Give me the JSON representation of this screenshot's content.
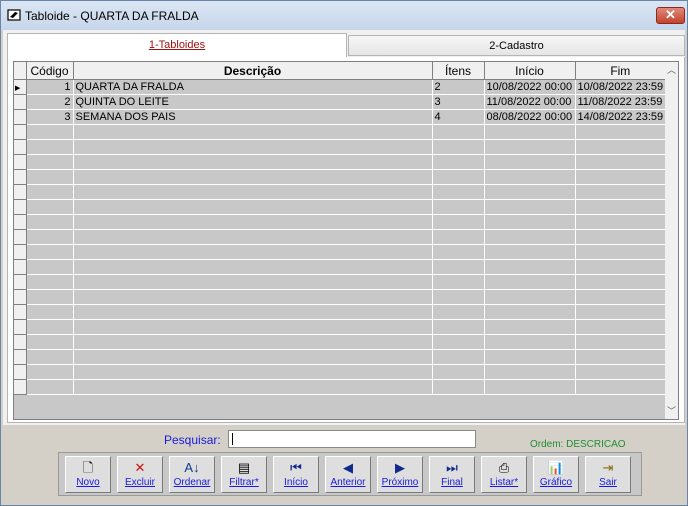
{
  "window": {
    "title": "Tabloide - QUARTA DA FRALDA",
    "close": "✕"
  },
  "tabs": [
    {
      "label": "1-Tabloides",
      "active": true
    },
    {
      "label": "2-Cadastro",
      "active": false
    }
  ],
  "grid": {
    "columns": [
      "Código",
      "Descrição",
      "Ítens",
      "Início",
      "Fim"
    ],
    "rows": [
      {
        "codigo": "1",
        "descricao": "QUARTA DA FRALDA",
        "itens": "2",
        "inicio": "10/08/2022 00:00",
        "fim": "10/08/2022 23:59"
      },
      {
        "codigo": "2",
        "descricao": "QUINTA DO LEITE",
        "itens": "3",
        "inicio": "11/08/2022 00:00",
        "fim": "11/08/2022 23:59"
      },
      {
        "codigo": "3",
        "descricao": "SEMANA DOS PAIS",
        "itens": "4",
        "inicio": "08/08/2022 00:00",
        "fim": "14/08/2022 23:59"
      }
    ]
  },
  "search": {
    "label": "Pesquisar:",
    "value": ""
  },
  "order": "Ordem: DESCRICAO",
  "toolbar": [
    {
      "label": "Novo",
      "icon": "new-document-icon",
      "glyph": "🗋"
    },
    {
      "label": "Excluir",
      "icon": "delete-x-icon",
      "glyph": "✕"
    },
    {
      "label": "Ordenar",
      "icon": "sort-az-icon",
      "glyph": "A↓"
    },
    {
      "label": "Filtrar*",
      "icon": "filter-icon",
      "glyph": "▤"
    },
    {
      "label": "Início",
      "icon": "first-record-icon",
      "glyph": "⏮"
    },
    {
      "label": "Anterior",
      "icon": "previous-record-icon",
      "glyph": "◀"
    },
    {
      "label": "Próximo",
      "icon": "next-record-icon",
      "glyph": "▶"
    },
    {
      "label": "Final",
      "icon": "last-record-icon",
      "glyph": "⏭"
    },
    {
      "label": "Listar*",
      "icon": "printer-icon",
      "glyph": "⎙"
    },
    {
      "label": "Gráfico",
      "icon": "chart-icon",
      "glyph": "📊"
    },
    {
      "label": "Sair",
      "icon": "exit-door-icon",
      "glyph": "⇥"
    }
  ]
}
